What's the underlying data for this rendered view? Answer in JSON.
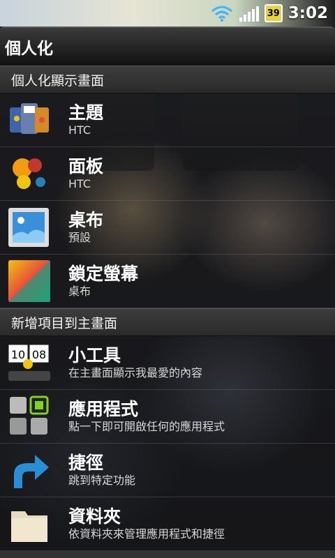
{
  "status_bar": {
    "battery": "39",
    "time": "3:02",
    "icons": [
      "wifi-icon",
      "signal-icon",
      "battery-icon"
    ]
  },
  "panel": {
    "title": "個人化",
    "sections": [
      {
        "header": "個人化顯示畫面",
        "items": [
          {
            "title": "主題",
            "subtitle": "HTC",
            "icon": "theme-icon"
          },
          {
            "title": "面板",
            "subtitle": "HTC",
            "icon": "skin-icon"
          },
          {
            "title": "桌布",
            "subtitle": "預設",
            "icon": "wallpaper-icon"
          },
          {
            "title": "鎖定螢幕",
            "subtitle": "桌布",
            "icon": "lock-screen-icon"
          }
        ]
      },
      {
        "header": "新增項目到主畫面",
        "items": [
          {
            "title": "小工具",
            "subtitle": "在主畫面顯示我最愛的內容",
            "icon": "widget-icon"
          },
          {
            "title": "應用程式",
            "subtitle": "點一下即可開啟任何的應用程式",
            "icon": "apps-icon"
          },
          {
            "title": "捷徑",
            "subtitle": "跳到特定功能",
            "icon": "shortcut-icon"
          },
          {
            "title": "資料夾",
            "subtitle": "依資料夾來管理應用程式和捷徑",
            "icon": "folder-icon"
          }
        ]
      }
    ]
  },
  "colors": {
    "battery": "#e6d43a",
    "title_bar": "#1a1a1a",
    "section_header": "#333333"
  }
}
